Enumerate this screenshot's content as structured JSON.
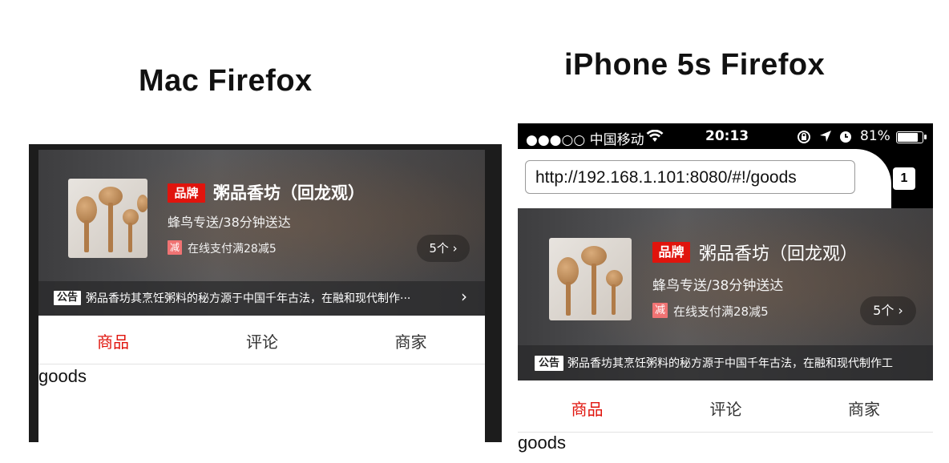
{
  "titles": {
    "mac": "Mac Firefox",
    "iphone": "iPhone 5s Firefox"
  },
  "shop": {
    "brand_tag": "品牌",
    "name": "粥品香坊（回龙观）",
    "delivery": "蜂鸟专送/38分钟送达",
    "promo_icon": "减",
    "promo_text": "在线支付满28减5",
    "promo_count": "5个 ›",
    "bulletin_tag": "公告",
    "bulletin_text_mac": "粥品香坊其烹饪粥料的秘方源于中国千年古法，在融和现代制作···",
    "bulletin_text_iphone": "粥品香坊其烹饪粥料的秘方源于中国千年古法，在融和现代制作工",
    "bulletin_chevron": "›"
  },
  "tabs": [
    "商品",
    "评论",
    "商家"
  ],
  "content": "goods",
  "iphone_status": {
    "carrier": "●●●○○ 中国移动",
    "time": "20:13",
    "battery": "81%"
  },
  "browser": {
    "url": "http://192.168.1.101:8080/#!/goods",
    "tab_count": "1"
  },
  "colors": {
    "accent": "#e0140d",
    "promo": "#f07373",
    "header_bg": "#4a4a4c"
  },
  "icons": [
    "wifi-icon",
    "lock-rotation-icon",
    "location-arrow-icon",
    "alarm-icon",
    "battery-icon",
    "chevron-right-icon"
  ]
}
